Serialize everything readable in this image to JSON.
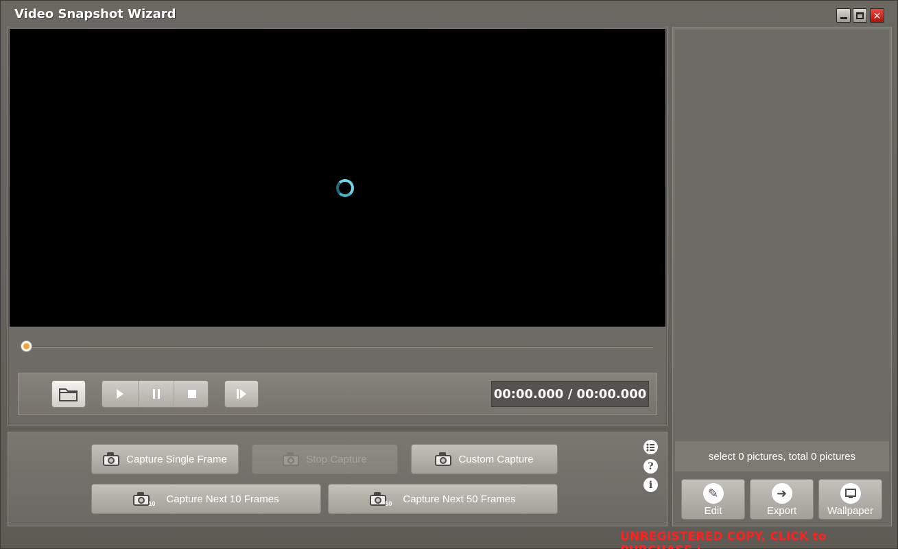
{
  "window": {
    "title": "Video Snapshot Wizard",
    "controls": {
      "minimize": "minimize-icon",
      "maximize": "maximize-icon",
      "close": "close-icon"
    }
  },
  "player": {
    "time_display": "00:00.000 / 00:00.000",
    "seek_progress": 0,
    "icons": {
      "open": "folder-icon",
      "play": "play-icon",
      "pause": "pause-icon",
      "stop": "stop-icon",
      "step": "step-forward-icon"
    }
  },
  "capture": {
    "single_frame": "Capture Single Frame",
    "stop_capture": "Stop Capture",
    "custom_capture": "Custom Capture",
    "next_10": "Capture Next 10 Frames",
    "next_10_badge": "10",
    "next_50": "Capture Next 50 Frames",
    "next_50_badge": "50",
    "side_icons": {
      "list": "list-icon",
      "help": "?",
      "info": "i"
    }
  },
  "gallery": {
    "status": "select 0 pictures, total 0 pictures",
    "edit_label": "Edit",
    "export_label": "Export",
    "wallpaper_label": "Wallpaper"
  },
  "footer": {
    "purchase_text": "UNREGISTERED COPY, CLICK to PURCHASE !"
  },
  "colors": {
    "accent_purchase": "#ff2020",
    "seek_thumb": "#f4a234",
    "spinner": "#6fd7ea",
    "close_button": "#d52018"
  }
}
